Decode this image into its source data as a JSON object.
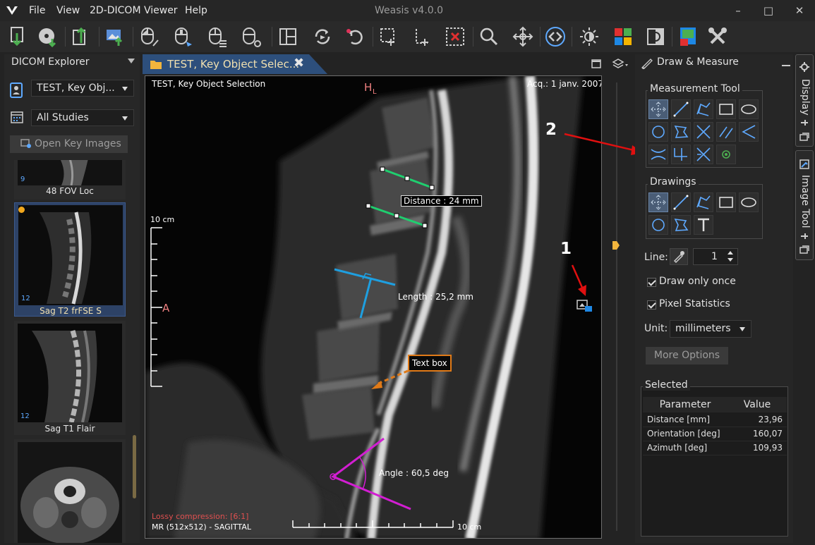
{
  "window": {
    "title": "Weasis v4.0.0"
  },
  "menu": [
    "File",
    "View",
    "2D-DICOM Viewer",
    "Help"
  ],
  "toolbar_icons": [
    "import-dicom-icon",
    "import-cd-icon",
    "export-dicom-icon",
    "export-image-icon",
    "mouse-left-action-icon",
    "mouse-middle-action-icon",
    "mouse-right-action-icon",
    "mouse-wheel-action-icon",
    "layout-icon",
    "synch-icon",
    "reset-icon",
    "measure-select-icon",
    "draw-select-icon",
    "delete-selection-icon",
    "zoom-icon",
    "pan-icon",
    "cine-icon",
    "display-icon",
    "lut-icon",
    "invert-icon",
    "export-view-icon",
    "tools-icon"
  ],
  "explorer": {
    "title": "DICOM Explorer",
    "patient": "TEST, Key Obj...",
    "studies": "All Studies",
    "open_key_images": "Open Key Images",
    "series": [
      {
        "name": "48 FOV Loc",
        "count": "9"
      },
      {
        "name": "Sag T2 frFSE S",
        "count": "12",
        "selected": true
      },
      {
        "name": "Sag T1 Flair",
        "count": "12"
      },
      {
        "name": "",
        "count": ""
      }
    ]
  },
  "tab": {
    "label": "TEST, Key Object Selec..."
  },
  "viewer": {
    "patient_name": "TEST, Key Object Selection",
    "acquisition": "Acq.: 1 janv. 2007",
    "orientation_top": "H",
    "orientation_top_sub": "L",
    "orientation_left": "A",
    "scale_label": "10 cm",
    "scale_label_bottom": "10 cm",
    "lossy": "Lossy compression:  [6:1]",
    "info": "MR (512x512) - SAGITTAL",
    "distance": "Distance : 24 mm",
    "length": "Length : 25,2 mm",
    "textbox": "Text box",
    "angle": "Angle : 60,5 deg",
    "callout_1": "1",
    "callout_2": "2"
  },
  "draw_measure": {
    "title": "Draw & Measure",
    "measurement_title": "Measurement Tool",
    "measurement_tools": [
      "selection-icon",
      "line-icon",
      "polyline-icon",
      "rectangle-icon",
      "ellipse-icon",
      "circle-icon",
      "polygon-icon",
      "perpendicular-icon",
      "parallel-icon",
      "angle-icon",
      "cobb-angle-icon",
      "open-angle-icon",
      "four-point-angle-icon",
      "pixel-info-icon"
    ],
    "drawings_title": "Drawings",
    "drawing_tools": [
      "selection-icon",
      "line-icon",
      "polyline-icon",
      "rectangle-icon",
      "ellipse-icon",
      "circle-icon",
      "polygon-icon",
      "text-icon"
    ],
    "line_label": "Line:",
    "line_value": "1",
    "draw_once": "Draw only once",
    "pixel_stats": "Pixel Statistics",
    "unit_label": "Unit:",
    "unit_value": "millimeters",
    "more_options": "More Options",
    "selected_title": "Selected",
    "table": {
      "headers": [
        "Parameter",
        "Value"
      ],
      "rows": [
        {
          "param": "Distance [mm]",
          "value": "23,96"
        },
        {
          "param": "Orientation [deg]",
          "value": "160,07"
        },
        {
          "param": "Azimuth [deg]",
          "value": "109,93"
        }
      ]
    }
  },
  "side_tabs": [
    "Display",
    "Image Tool"
  ],
  "colors": {
    "accent_blue": "#2d4f7c",
    "measure_green": "#1fcf6f",
    "measure_blue": "#1e9fe0",
    "annot_orange": "#e07a18",
    "angle_magenta": "#d21ed2",
    "callout_red": "#e01010"
  }
}
